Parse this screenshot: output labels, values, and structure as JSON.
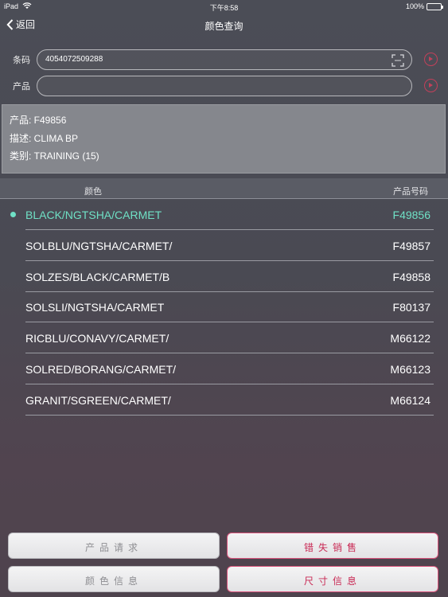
{
  "status_bar": {
    "device": "iPad",
    "time": "下午8:58",
    "battery": "100%"
  },
  "nav": {
    "back_label": "返回",
    "title": "颜色查询"
  },
  "form": {
    "barcode_label": "条码",
    "barcode_value": "4054072509288",
    "product_label": "产品",
    "product_value": ""
  },
  "info": {
    "product": "产品: F49856",
    "description": "描述: CLIMA BP",
    "category": "类别: TRAINING (15)"
  },
  "table": {
    "headers": {
      "color": "颜色",
      "code": "产品号码"
    },
    "rows": [
      {
        "color": "BLACK/NGTSHA/CARMET",
        "code": "F49856",
        "selected": true
      },
      {
        "color": "SOLBLU/NGTSHA/CARMET/",
        "code": "F49857"
      },
      {
        "color": "SOLZES/BLACK/CARMET/B",
        "code": "F49858"
      },
      {
        "color": "SOLSLI/NGTSHA/CARMET",
        "code": "F80137"
      },
      {
        "color": "RICBLU/CONAVY/CARMET/",
        "code": "M66122"
      },
      {
        "color": "SOLRED/BORANG/CARMET/",
        "code": "M66123"
      },
      {
        "color": "GRANIT/SGREEN/CARMET/",
        "code": "M66124"
      }
    ]
  },
  "buttons": {
    "product_request": "产品请求",
    "lost_sales": "错失销售",
    "color_info": "颜色信息",
    "size_info": "尺寸信息"
  },
  "colors": {
    "accent": "#6fe1c6",
    "alert": "#c92a55",
    "info_bg": "#85878d"
  },
  "icons": [
    "wifi-icon",
    "battery-icon",
    "back-chevron-icon",
    "scan-icon",
    "clear-icon",
    "selected-dot-icon"
  ]
}
